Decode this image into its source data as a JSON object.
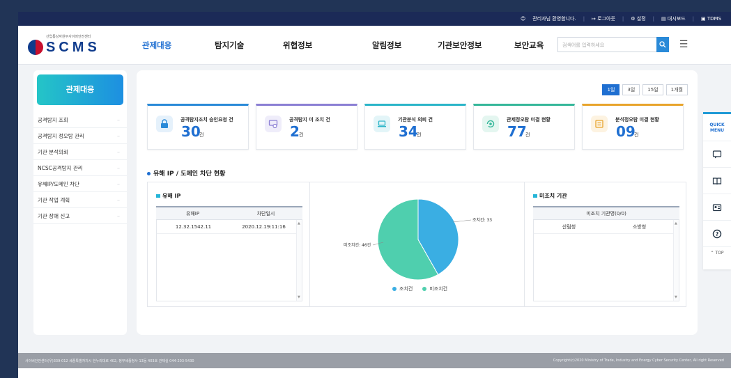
{
  "util_bar": {
    "greeting": "관리자님 환영합니다.",
    "logout": "로그아웃",
    "settings": "설정",
    "dashboard": "대시보드",
    "tdms": "TDMS"
  },
  "logo": {
    "org": "산업통상자원부사이버안전센터",
    "wordmark": "SCMS"
  },
  "nav": [
    "관제대응",
    "탐지기술",
    "위협정보",
    "알림정보",
    "기관보안정보",
    "보안교육"
  ],
  "search": {
    "placeholder": "검색어를 입력하세요"
  },
  "sidebar": {
    "title": "관제대응",
    "items": [
      "공격탐지 조회",
      "공격탐지 정오탐 관리",
      "기관 분석의뢰",
      "NCSC공격탐지 관리",
      "유해IP/도메인 차단",
      "기관 작업 계획",
      "기관 장애 신고"
    ]
  },
  "periods": [
    "1일",
    "3일",
    "15일",
    "1개월"
  ],
  "cards": [
    {
      "title": "공격탐지조치 승인요청 건",
      "value": "30",
      "unit": "건",
      "color": "#2a8ad8"
    },
    {
      "title": "공격탐지 미 조치 건",
      "value": "2",
      "unit": "건",
      "color": "#8b7fd4"
    },
    {
      "title": "기관분석 의뢰 건",
      "value": "34",
      "unit": "건",
      "color": "#2bb5c8"
    },
    {
      "title": "관제정오탐 미결 현황",
      "value": "77",
      "unit": "건",
      "color": "#35b79a"
    },
    {
      "title": "분석정오탐 미결 현황",
      "value": "09",
      "unit": "건",
      "color": "#e8a42c"
    }
  ],
  "section_title": "유해 IP / 도메인 차단 현황",
  "ip_table": {
    "title": "유해 IP",
    "headers": [
      "유해IP",
      "차단일시"
    ],
    "rows": [
      [
        "12.32.1542.11",
        "2020.12.19:11:16"
      ]
    ]
  },
  "pie": {
    "label_done": "조치건: 33",
    "label_pending": "미조치건: 46건",
    "legend_done": "조치건",
    "legend_pending": "미조치건"
  },
  "chart_data": {
    "type": "pie",
    "categories": [
      "조치건",
      "미조치건"
    ],
    "values": [
      33,
      46
    ],
    "colors": [
      "#3aaee3",
      "#4fcfae"
    ]
  },
  "org_table": {
    "title": "미조치 기관",
    "caption": "미조치 기관명(0/0)",
    "headers": [
      "산림청",
      "소방청"
    ]
  },
  "quick_menu": {
    "title_1": "QUICK",
    "title_2": "MENU",
    "top": "TOP"
  },
  "footer": {
    "left": "사이버안전센터(우)339-012 세종특별자치시 한누리대로 402, 정부세종청사 13동 403호 관제실 044-203-5430",
    "right": "Copyright(c)2020 Ministry of Trade, Industry and Energy Cyber Security Center, All right Reserved"
  }
}
